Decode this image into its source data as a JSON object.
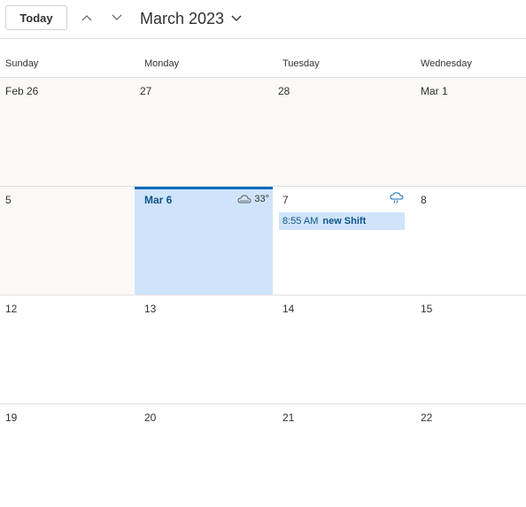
{
  "toolbar": {
    "today_label": "Today",
    "month_title": "March 2023"
  },
  "day_headers": [
    "Sunday",
    "Monday",
    "Tuesday",
    "Wednesday"
  ],
  "weeks": [
    {
      "days": [
        {
          "label": "Feb 26",
          "muted": true
        },
        {
          "label": "27",
          "muted": true
        },
        {
          "label": "28",
          "muted": true
        },
        {
          "label": "Mar 1",
          "muted": true
        }
      ]
    },
    {
      "days": [
        {
          "label": "5",
          "muted": true
        },
        {
          "label": "Mar 6",
          "today": true,
          "weather": {
            "icon": "cloudy-icon",
            "temp": "33°"
          }
        },
        {
          "label": "7",
          "weather": {
            "icon": "rain-cloud-icon"
          },
          "event": {
            "time": "8:55 AM",
            "title": "new Shift"
          }
        },
        {
          "label": "8"
        }
      ]
    },
    {
      "days": [
        {
          "label": "12"
        },
        {
          "label": "13"
        },
        {
          "label": "14"
        },
        {
          "label": "15"
        }
      ]
    },
    {
      "days": [
        {
          "label": "19"
        },
        {
          "label": "20"
        },
        {
          "label": "21"
        },
        {
          "label": "22"
        }
      ]
    }
  ],
  "colors": {
    "accent": "#0f6cbd",
    "today_bg": "#cfe4fa",
    "muted_bg": "#faf9f8",
    "grid_line": "#e1dfdd",
    "event_text": "#0f548c"
  }
}
